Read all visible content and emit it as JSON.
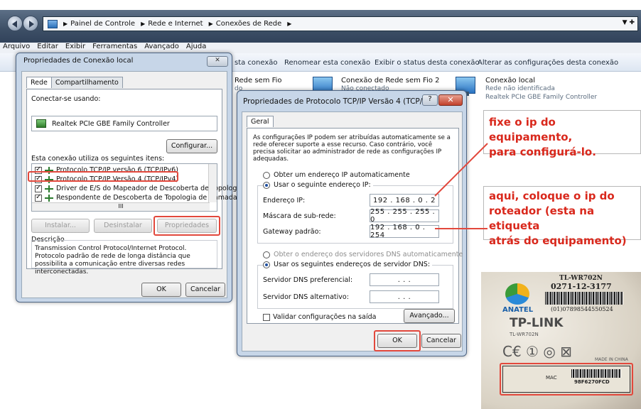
{
  "explorer": {
    "breadcrumbs": [
      "Painel de Controle",
      "Rede e Internet",
      "Conexões de Rede"
    ],
    "menu": [
      "Arquivo",
      "Editar",
      "Exibir",
      "Ferramentas",
      "Avançado",
      "Ajuda"
    ],
    "commands": [
      "sta conexão",
      "Renomear esta conexão",
      "Exibir o status desta conexão",
      "Alterar as configurações desta conexão"
    ],
    "connections": [
      {
        "title": "Rede sem Fio",
        "sub": "do"
      },
      {
        "title": "Conexão de Rede sem Fio 2",
        "sub": "Não conectado"
      },
      {
        "title": "Conexão local",
        "sub": "Rede não identificada",
        "sub2": "Realtek PCIe GBE Family Controller"
      }
    ]
  },
  "win1": {
    "title": "Propriedades de Conexão local",
    "tabs": [
      "Rede",
      "Compartilhamento"
    ],
    "connect_using_label": "Conectar-se usando:",
    "adapter": "Realtek PCIe GBE Family Controller",
    "configure_btn": "Configurar...",
    "items_label": "Esta conexão utiliza os seguintes itens:",
    "items": [
      "Protocolo TCP/IP versão 6 (TCP/IPv6)",
      "Protocolo TCP/IP Versão 4 (TCP/IPv4)",
      "Driver de E/S do Mapeador de Descoberta de Topolog",
      "Respondente de Descoberta de Topologia de Camada"
    ],
    "scroll_dots": "III",
    "install_btn": "Instalar...",
    "uninstall_btn": "Desinstalar",
    "properties_btn": "Propriedades",
    "desc_label": "Descrição",
    "desc_text": "Transmission Control Protocol/Internet Protocol. Protocolo padrão de rede de longa distância que possibilita a comunicação entre diversas redes interconectadas.",
    "ok_btn": "OK",
    "cancel_btn": "Cancelar"
  },
  "win2": {
    "title": "Propriedades de Protocolo TCP/IP Versão 4 (TCP/IPv4)",
    "help": "?",
    "tab": "Geral",
    "intro": "As configurações IP podem ser atribuídas automaticamente se a rede oferecer suporte a esse recurso. Caso contrário, você precisa solicitar ao administrador de rede as configurações IP adequadas.",
    "auto_ip": "Obter um endereço IP automaticamente",
    "use_ip": "Usar o seguinte endereço IP:",
    "ip_label": "Endereço IP:",
    "ip_value": "192 . 168 . 0 . 2",
    "mask_label": "Máscara de sub-rede:",
    "mask_value": "255 . 255 . 255 . 0",
    "gw_label": "Gateway padrão:",
    "gw_value": "192 . 168 . 0 . 254",
    "auto_dns": "Obter o endereço dos servidores DNS automaticamente",
    "use_dns": "Usar os seguintes endereços de servidor DNS:",
    "dns1_label": "Servidor DNS preferencial:",
    "dns1_value": ". . .",
    "dns2_label": "Servidor DNS alternativo:",
    "dns2_value": ". . .",
    "validate": "Validar configurações na saída",
    "advanced_btn": "Avançado...",
    "ok_btn": "OK",
    "cancel_btn": "Cancelar"
  },
  "annotations": {
    "a1_line1": "fixe o ip do equipamento,",
    "a1_line2": "para configurá-lo.",
    "a2_line1": "aqui, coloque o ip do",
    "a2_line2": "roteador (esta na etiqueta",
    "a2_line3": "atrás do equipamento)"
  },
  "photo": {
    "model": "TL-WR702N",
    "serial": "0271-12-3177",
    "barcode_num": "(01)07898544550524",
    "anatel": "ANATEL",
    "brand": "TP-LINK",
    "brand_model": "TL-WR702N",
    "marks": "C€ ① ◎ ⊠",
    "made": "MADE IN CHINA",
    "mac_label": "MAC",
    "mac_value": "98F6270FCD"
  },
  "colors": {
    "annotation": "#d9281c",
    "highlight": "#e2483c"
  }
}
